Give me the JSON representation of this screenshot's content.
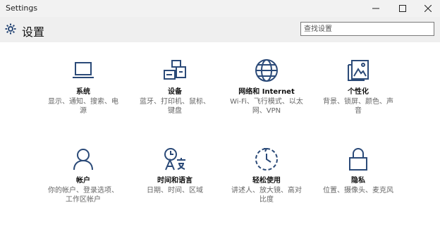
{
  "window": {
    "title": "Settings"
  },
  "header": {
    "title": "设置",
    "search_placeholder": "查找设置"
  },
  "tiles": [
    {
      "name": "系统",
      "desc": "显示、通知、搜索、电源",
      "icon": "laptop-icon"
    },
    {
      "name": "设备",
      "desc": "蓝牙、打印机、鼠标、键盘",
      "icon": "devices-icon"
    },
    {
      "name": "网络和 Internet",
      "desc": "Wi-Fi、飞行模式、以太网、VPN",
      "icon": "globe-icon"
    },
    {
      "name": "个性化",
      "desc": "背景、锁屏、颜色、声音",
      "icon": "personalization-icon"
    },
    {
      "name": "帐户",
      "desc": "你的帐户、登录选项、工作区帐户",
      "icon": "person-icon"
    },
    {
      "name": "时间和语言",
      "desc": "日期、时间、区域",
      "icon": "time-language-icon"
    },
    {
      "name": "轻松使用",
      "desc": "讲述人、放大镜、高对比度",
      "icon": "ease-of-access-icon"
    },
    {
      "name": "隐私",
      "desc": "位置、摄像头、麦克风",
      "icon": "lock-icon"
    }
  ],
  "colors": {
    "icon_blue": "#2b4a78",
    "header_bg": "#efefef"
  }
}
